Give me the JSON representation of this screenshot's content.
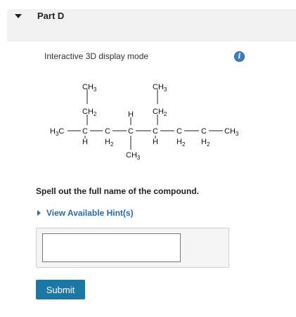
{
  "part": {
    "title": "Part D"
  },
  "display": {
    "mode_label": "Interactive 3D display mode",
    "info_symbol": "i"
  },
  "molecule": {
    "labels": {
      "top_left": "CH",
      "top_left_sub": "3",
      "upper_left": "CH",
      "upper_left_sub": "2",
      "top_right": "CH",
      "top_right_sub": "3",
      "upper_right": "CH",
      "upper_right_sub": "2",
      "chain_start": "H",
      "chain_start_sub": "3",
      "chain_start_c": "C",
      "c1": "C",
      "c1_h": "H",
      "c2": "C",
      "c2_h": "H",
      "c2_sub": "2",
      "c3_h_top": "H",
      "c3": "C",
      "c4": "C",
      "c4_h": "H",
      "c5": "C",
      "c5_h": "H",
      "c5_sub": "2",
      "c6": "C",
      "c6_h": "H",
      "c6_sub": "2",
      "chain_end": "CH",
      "chain_end_sub": "3",
      "bottom": "CH",
      "bottom_sub": "3"
    }
  },
  "question": {
    "text": "Spell out the full name of the compound."
  },
  "hint": {
    "label": "View Available Hint(s)"
  },
  "answer": {
    "value": "",
    "placeholder": ""
  },
  "submit": {
    "label": "Submit"
  }
}
